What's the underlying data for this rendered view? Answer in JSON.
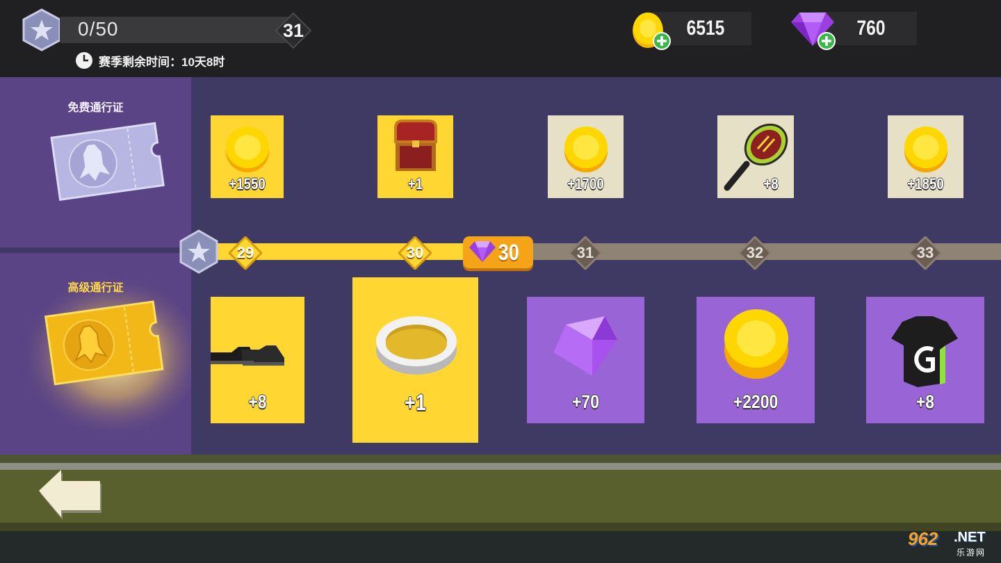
{
  "header": {
    "xp_progress": "0/50",
    "xp_fraction": 0,
    "level": "31",
    "season_timer_label": "赛季剩余时间：10天8时",
    "coins": "6515",
    "gems": "760"
  },
  "passes": {
    "free_title": "免费通行证",
    "premium_title": "高级通行证"
  },
  "free_rewards": [
    {
      "item": "coins",
      "amount": "+1550"
    },
    {
      "item": "chest",
      "amount": "+1"
    },
    {
      "item": "coins",
      "amount": "+1700"
    },
    {
      "item": "racket",
      "amount": "+8"
    },
    {
      "item": "coins",
      "amount": "+1850"
    }
  ],
  "levels": [
    "29",
    "30",
    "30",
    "31",
    "32",
    "33"
  ],
  "premium_rewards": [
    {
      "item": "shoes",
      "amount": "+8"
    },
    {
      "item": "wristband",
      "amount": "+1"
    },
    {
      "item": "gems",
      "amount": "+70"
    },
    {
      "item": "coins",
      "amount": "+2200"
    },
    {
      "item": "shirt",
      "amount": "+8"
    }
  ],
  "watermark": {
    "brand": "962",
    "net": ".NET",
    "site": "乐游网"
  },
  "colors": {
    "unlocked_tile": "#ffd632",
    "locked_free_tile": "#e6e1c6",
    "premium_locked_tile": "#9965d6",
    "progress_fill": "#ffd632",
    "progress_empty": "#8f8375",
    "current_level": "#f5a317"
  }
}
